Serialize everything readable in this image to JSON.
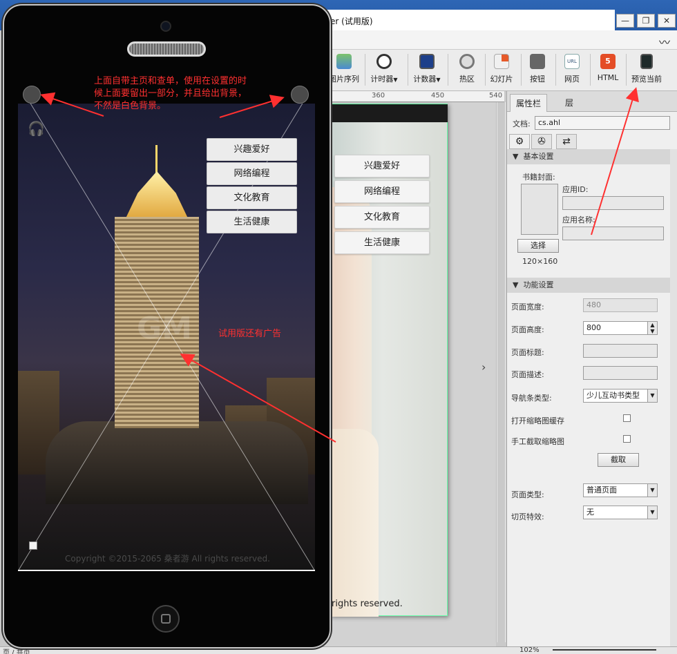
{
  "window": {
    "title": "er (试用版)",
    "controls": [
      "—",
      "❐",
      "✕"
    ]
  },
  "toolbar": {
    "items": [
      {
        "label": "图片序列",
        "icon": "image-sequence-icon"
      },
      {
        "label": "计时器",
        "icon": "timer-icon",
        "dropdown": true
      },
      {
        "label": "计数器",
        "icon": "counter-icon",
        "dropdown": true
      },
      {
        "label": "热区",
        "icon": "hotspot-icon"
      },
      {
        "label": "幻灯片",
        "icon": "slideshow-icon"
      },
      {
        "label": "按钮",
        "icon": "button-icon"
      },
      {
        "label": "网页",
        "icon": "webpage-icon",
        "badge": "URL"
      },
      {
        "label": "HTML",
        "icon": "html5-icon",
        "badge": "5"
      },
      {
        "label": "预览当前",
        "icon": "preview-icon"
      }
    ]
  },
  "ruler": {
    "ticks": [
      "360",
      "450",
      "540"
    ]
  },
  "page_preview": {
    "menu": [
      "兴趣爱好",
      "网络编程",
      "文化教育",
      "生活健康"
    ],
    "copyright_fragment": "rights reserved."
  },
  "panel": {
    "tabs": [
      "属性栏",
      "层"
    ],
    "doc_label": "文档:",
    "doc_value": "cs.ahl",
    "sections": {
      "basic": "基本设置",
      "function": "功能设置"
    },
    "cover_label": "书籍封面:",
    "app_id_label": "应用ID:",
    "app_id_value": "",
    "app_name_label": "应用名称:",
    "app_name_value": "",
    "select_button": "选择",
    "cover_size": "120×160",
    "page_width_label": "页面宽度:",
    "page_width_value": "480",
    "page_height_label": "页面高度:",
    "page_height_value": "800",
    "page_title_label": "页面标题:",
    "page_title_value": "",
    "page_desc_label": "页面描述:",
    "page_desc_value": "",
    "nav_type_label": "导航条类型:",
    "nav_type_value": "少儿互动书类型",
    "open_thumb_cache_label": "打开缩略图缓存",
    "manual_thumb_label": "手工截取缩略图",
    "capture_button": "截取",
    "page_type_label": "页面类型:",
    "page_type_value": "普通页面",
    "page_effect_label": "切页特效:",
    "page_effect_value": "无"
  },
  "phone": {
    "menu": [
      "兴趣爱好",
      "网络编程",
      "文化教育",
      "生活健康"
    ],
    "watermark": "GM",
    "copyright": "Copyright ©2015-2065 桑者游 All rights reserved."
  },
  "annotations": {
    "top_note_line1": "上面自带主页和查单，使用在设置的时",
    "top_note_line2": "候上面要留出一部分，并且给出背景，",
    "top_note_line3": "不然是白色背景。",
    "ad_note": "试用版还有广告"
  },
  "statusbar": {
    "left": "页 / 共页",
    "zoom": "102%"
  },
  "colors": {
    "annotation": "#ff3030",
    "title_bar": "#2e66b5"
  }
}
